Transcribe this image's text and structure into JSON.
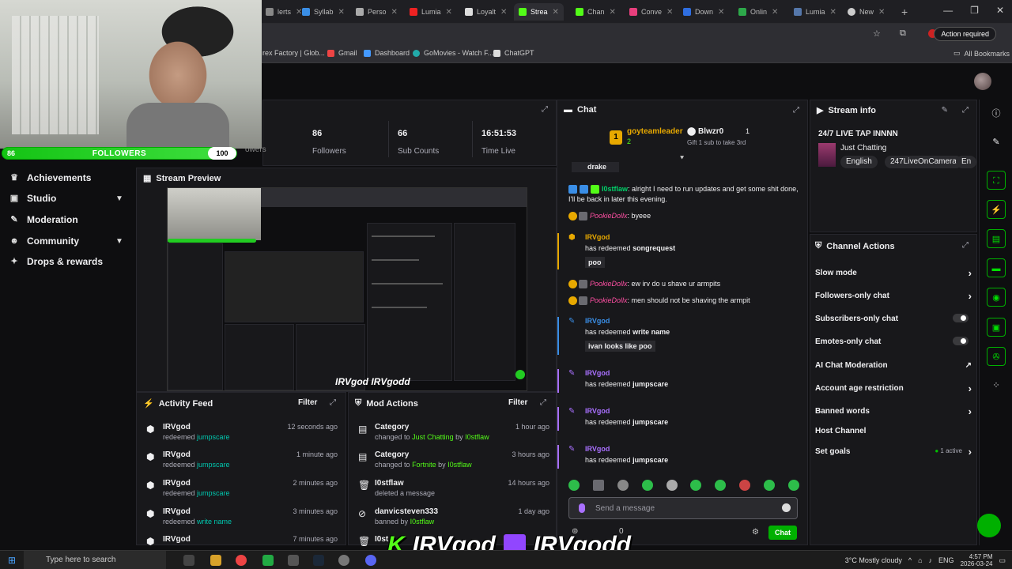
{
  "browser": {
    "tabs": [
      "lerts",
      "Syllab",
      "Perso",
      "Lumia",
      "Loyalt",
      "Strea",
      "Chan",
      "Conve",
      "Down",
      "Onlin",
      "Lumia",
      "New"
    ],
    "active_tab_index": 5,
    "action_required": "Action required",
    "bookmarks": [
      "rex Factory | Glob...",
      "Gmail",
      "Dashboard",
      "GoMovies - Watch F...",
      "ChatGPT"
    ],
    "all_bookmarks": "All Bookmarks"
  },
  "webcam": {
    "follower_goal": {
      "current": "86",
      "label": "FOLLOWERS",
      "target": "100",
      "progress": 0.86
    }
  },
  "nav": {
    "ghost_label": "owers",
    "items": [
      {
        "label": "Achievements",
        "icon": "trophy-icon",
        "has_children": false
      },
      {
        "label": "Studio",
        "icon": "studio-icon",
        "has_children": true
      },
      {
        "label": "Moderation",
        "icon": "wrench-icon",
        "has_children": false
      },
      {
        "label": "Community",
        "icon": "people-icon",
        "has_children": true
      },
      {
        "label": "Drops & rewards",
        "icon": "gift-icon",
        "has_children": false
      }
    ]
  },
  "stats": [
    {
      "value": "86",
      "label": "Followers"
    },
    {
      "value": "66",
      "label": "Sub Counts"
    },
    {
      "value": "16:51:53",
      "label": "Time Live"
    }
  ],
  "preview": {
    "title": "Stream Preview",
    "overlay_text": "IRVgod  IRVgodd"
  },
  "activity_feed": {
    "title": "Activity Feed",
    "filter": "Filter",
    "rows": [
      {
        "user": "IRVgod",
        "action": "redeemed",
        "item": "jumpscare",
        "time": "12 seconds ago"
      },
      {
        "user": "IRVgod",
        "action": "redeemed",
        "item": "jumpscare",
        "time": "1 minute ago"
      },
      {
        "user": "IRVgod",
        "action": "redeemed",
        "item": "jumpscare",
        "time": "2 minutes ago"
      },
      {
        "user": "IRVgod",
        "action": "redeemed",
        "item": "write name",
        "time": "3 minutes ago"
      },
      {
        "user": "IRVgod",
        "action": "",
        "item": "",
        "time": "7 minutes ago"
      }
    ]
  },
  "mod_actions": {
    "title": "Mod Actions",
    "filter": "Filter",
    "rows": [
      {
        "title": "Category",
        "line": "changed to",
        "target": "Just Chatting",
        "by": "by",
        "mod": "I0stflaw",
        "time": "1 hour ago"
      },
      {
        "title": "Category",
        "line": "changed to",
        "target": "Fortnite",
        "by": "by",
        "mod": "I0stflaw",
        "time": "3 hours ago"
      },
      {
        "title": "I0stflaw",
        "line": "deleted a message",
        "target": "",
        "by": "",
        "mod": "",
        "time": "14 hours ago"
      },
      {
        "title": "danvicsteven333",
        "line": "banned by",
        "target": "",
        "by": "",
        "mod": "I0stflaw",
        "time": "1 day ago"
      },
      {
        "title": "I0st",
        "line": "",
        "target": "",
        "by": "",
        "mod": "",
        "time": "1 da"
      }
    ]
  },
  "chat": {
    "title": "Chat",
    "hype": {
      "rank": "1",
      "leader": "goyteamleader",
      "leader_count": "2",
      "second": "Blwzr0",
      "second_count": "1",
      "gift_note": "Gift 1 sub to take 3rd"
    },
    "messages": [
      {
        "user": "",
        "text": "drake"
      },
      {
        "user": "I0stflaw",
        "text": "alright I need to run updates and get some shit done, I'll be back in later this evening."
      },
      {
        "user": "PookieDollx",
        "text": "byeee"
      }
    ],
    "redeem1": {
      "user": "IRVgod",
      "text": "has redeemed",
      "reward": "songrequest",
      "input": "poo"
    },
    "messages2": [
      {
        "user": "PookieDollx",
        "text": "ew irv do u shave ur armpits"
      },
      {
        "user": "PookieDollx",
        "text": "men should not be shaving the armpit"
      }
    ],
    "redeem2": {
      "user": "IRVgod",
      "text": "has redeemed",
      "reward": "write name",
      "input": "ivan looks like poo"
    },
    "redeem3": {
      "user": "IRVgod",
      "text": "has redeemed",
      "reward": "jumpscare"
    },
    "redeem4": {
      "user": "IRVgod",
      "text": "has redeemed",
      "reward": "jumpscare"
    },
    "redeem5": {
      "user": "IRVgod",
      "text": "has redeemed",
      "reward": "jumpscare"
    },
    "input_placeholder": "Send a message",
    "points": "0",
    "send_label": "Chat"
  },
  "stream_info": {
    "title": "Stream info",
    "stream_title": "24/7 LIVE TAP INNNN",
    "category": "Just Chatting",
    "tags": [
      "English",
      "247LiveOnCamera",
      "En"
    ]
  },
  "channel_actions": {
    "title": "Channel Actions",
    "items": [
      {
        "label": "Slow mode",
        "control": "chevron"
      },
      {
        "label": "Followers-only chat",
        "control": "chevron"
      },
      {
        "label": "Subscribers-only chat",
        "control": "toggle"
      },
      {
        "label": "Emotes-only chat",
        "control": "toggle"
      },
      {
        "label": "AI Chat Moderation",
        "control": "external"
      },
      {
        "label": "Account age restriction",
        "control": "chevron"
      },
      {
        "label": "Banned words",
        "control": "chevron"
      },
      {
        "label": "Host Channel",
        "control": "none"
      },
      {
        "label": "Set goals",
        "control": "chevron",
        "status": "1 active"
      }
    ]
  },
  "overlay_brand": {
    "kick": "IRVgod",
    "twitch": "IRVgodd"
  },
  "taskbar": {
    "search_placeholder": "Type here to search",
    "weather": "3°C  Mostly cloudy",
    "lang": "ENG",
    "time": "4:57 PM",
    "date": "2026-03-24"
  },
  "colors": {
    "accent": "#00b000",
    "kick_green": "#53fc18",
    "twitch_purple": "#9146ff",
    "panel": "#18181b",
    "bg": "#0e0e10"
  }
}
